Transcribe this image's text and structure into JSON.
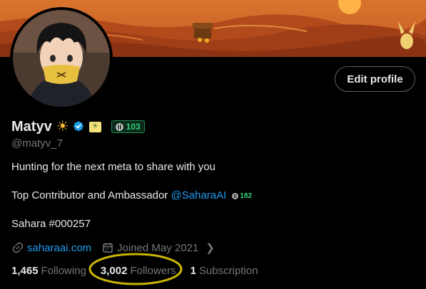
{
  "profile": {
    "display_name": "Matyv",
    "handle": "@matyv_7",
    "badge_score": "103",
    "edit_button": "Edit profile"
  },
  "bio": {
    "line1": "Hunting for the next meta to share with you",
    "line2_prefix": "Top Contributor and Ambassador ",
    "line2_mention": "@SaharaAI",
    "line2_badge": "182",
    "line3": "Sahara #000257"
  },
  "meta": {
    "website": "saharaai.com",
    "joined": "Joined May 2021"
  },
  "stats": {
    "following_count": "1,465",
    "following_label": "Following",
    "followers_count": "3,002",
    "followers_label": "Followers",
    "subscription_count": "1",
    "subscription_label": "Subscription"
  },
  "colors": {
    "accent": "#1d9bf0",
    "badge_green": "#2ed47a",
    "highlight": "#c9b400"
  },
  "icons": [
    "sun-icon",
    "verified-icon",
    "flag-icon",
    "badge-icon",
    "link-icon",
    "calendar-icon",
    "chevron-right-icon"
  ]
}
